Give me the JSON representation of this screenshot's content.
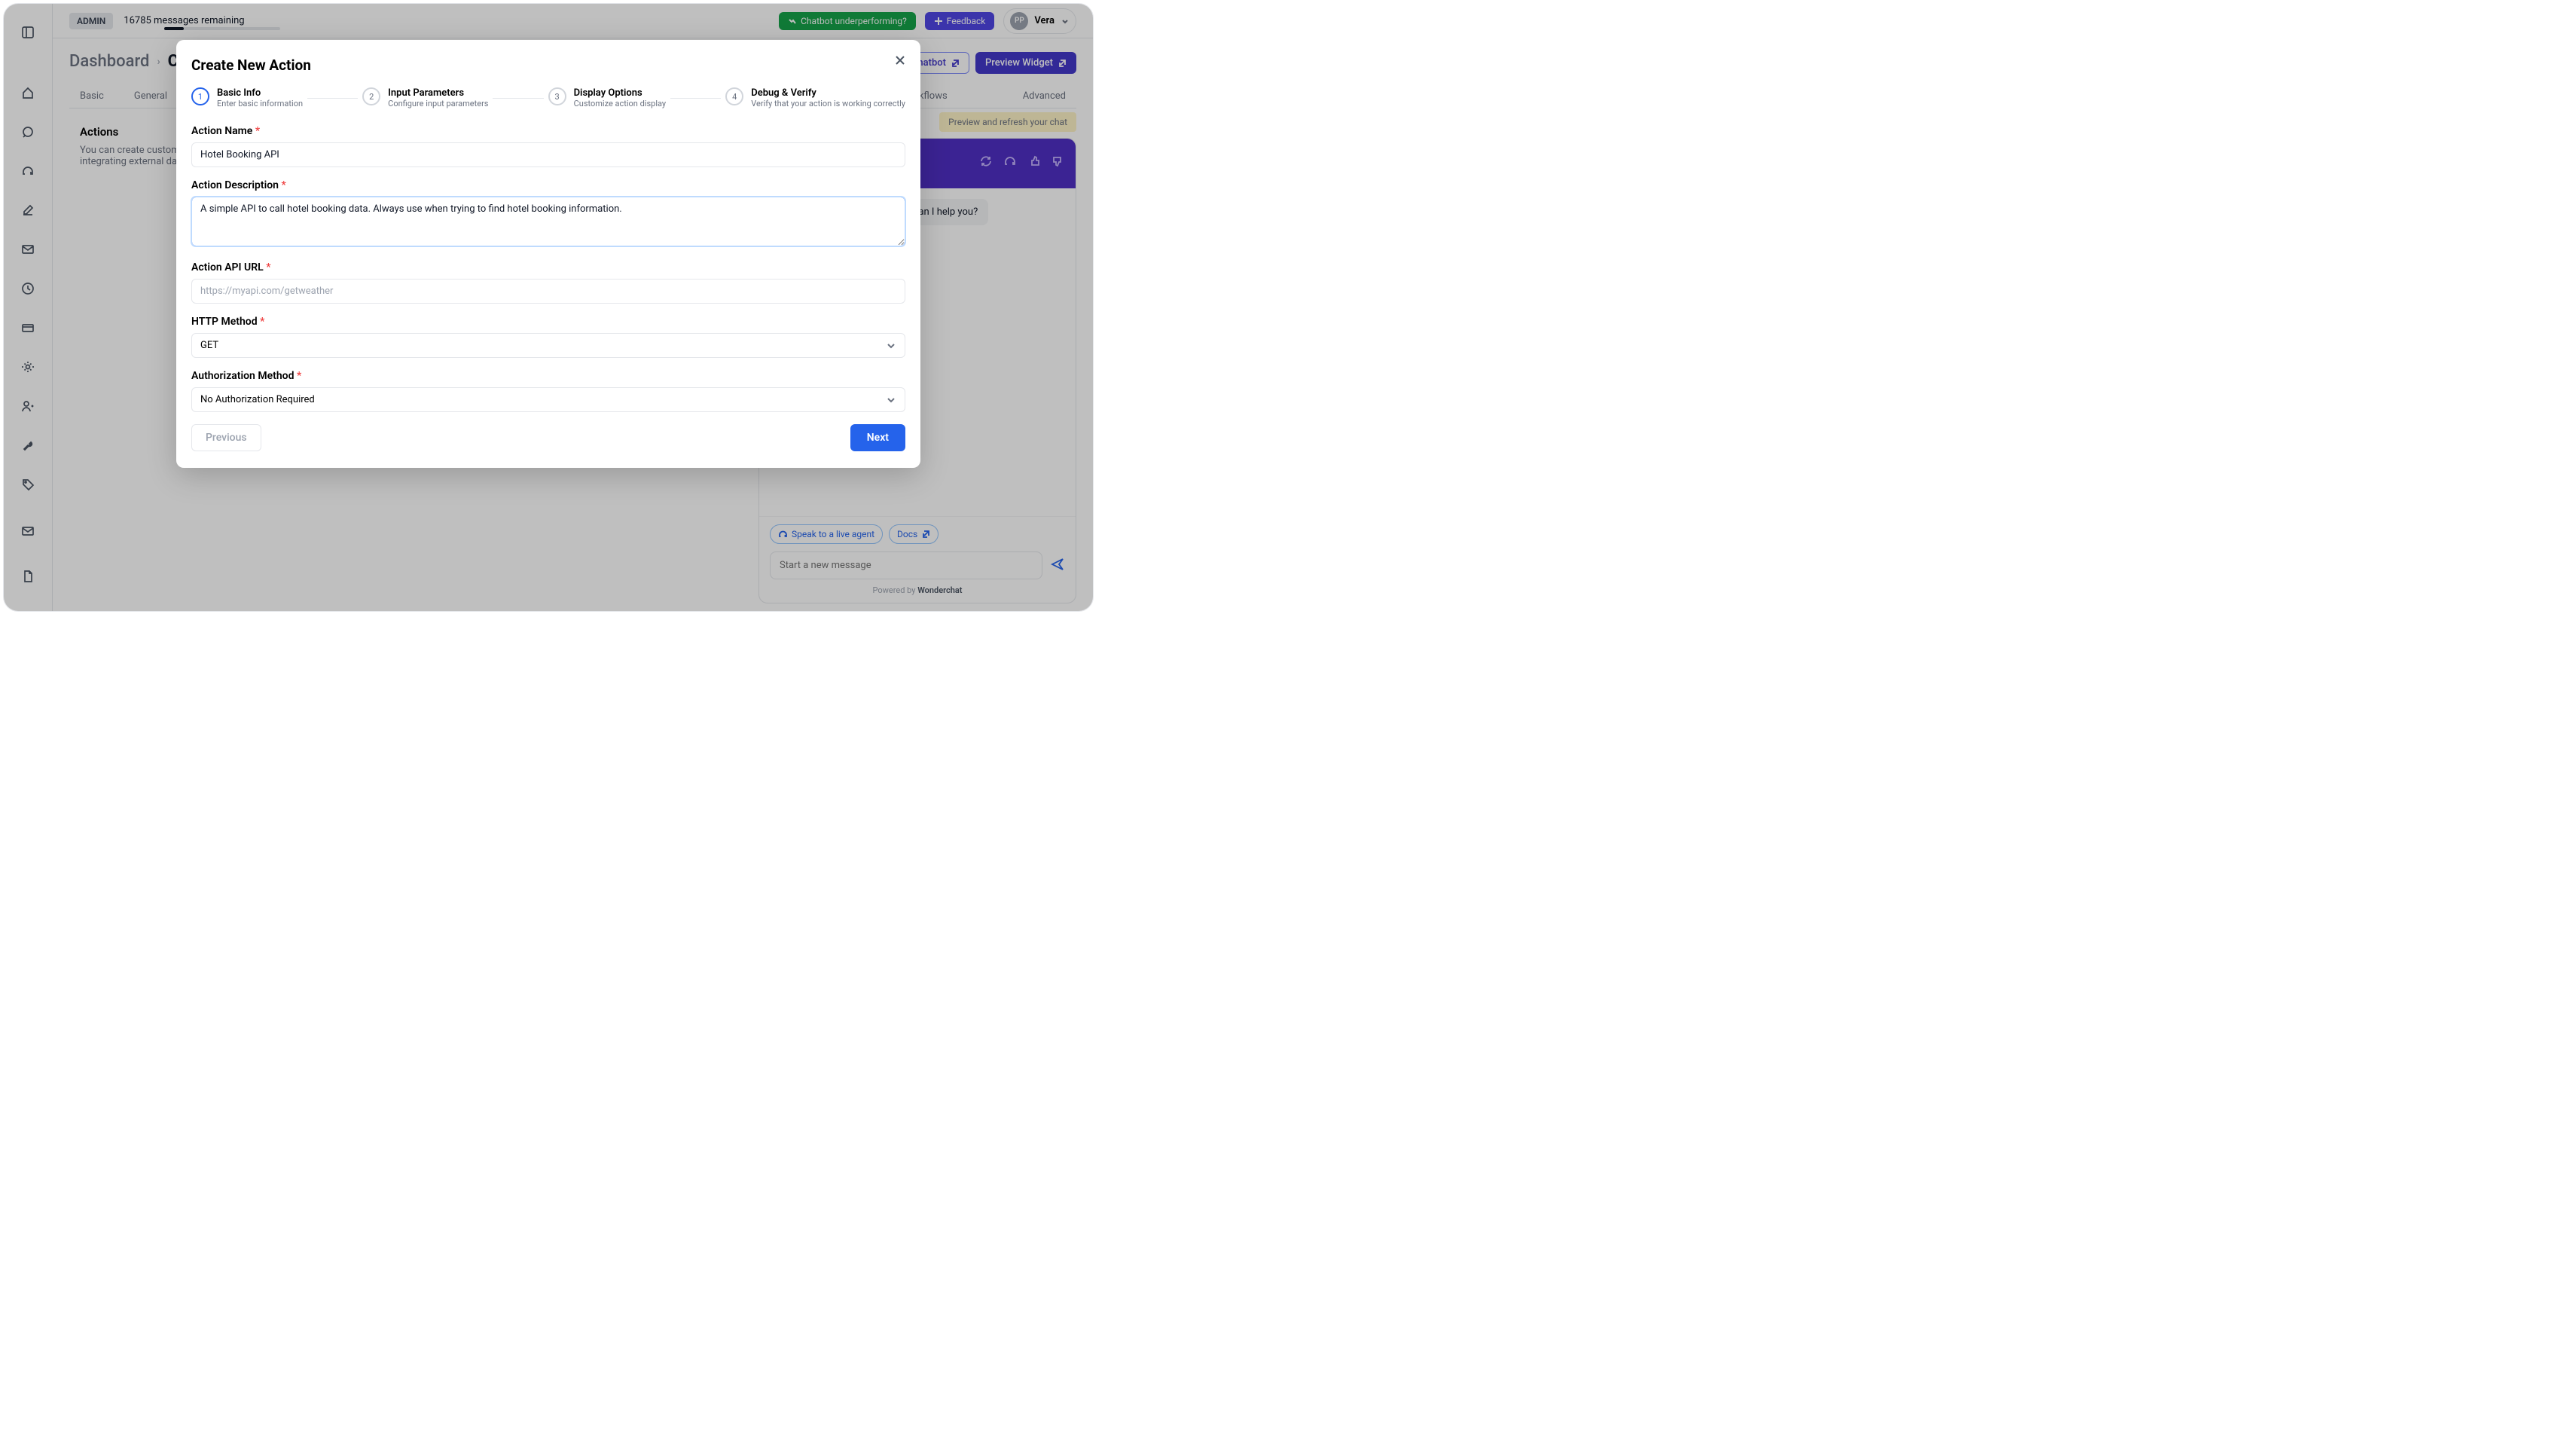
{
  "topbar": {
    "admin_badge": "ADMIN",
    "messages_remaining": "16785 messages remaining",
    "under_btn": "Chatbot underperforming?",
    "feedback_btn": "Feedback",
    "user": {
      "initials": "PP",
      "name": "Vera"
    }
  },
  "breadcrumb": {
    "root": "Dashboard",
    "current": "Chatbot"
  },
  "page_actions": {
    "test_chatbot": "Test Chatbot",
    "preview_widget": "Preview Widget"
  },
  "tabs": {
    "basic": "Basic",
    "general": "General",
    "workflows": "Workflows",
    "advanced": "Advanced"
  },
  "alert": "Preview and refresh your chat",
  "section": {
    "title": "Actions",
    "desc": "You can create custom actions that your chatbot will call when needed. This is particularly useful for integrating external data sources."
  },
  "chat": {
    "greeting": "Hi, I am your AI assistant, how can I help you?",
    "live_agent": "Speak to a live agent",
    "docs": "Docs",
    "placeholder": "Start a new message",
    "powered_prefix": "Powered by ",
    "powered_brand": "Wonderchat"
  },
  "modal": {
    "title": "Create New Action",
    "steps": [
      {
        "num": "1",
        "title": "Basic Info",
        "sub": "Enter basic information"
      },
      {
        "num": "2",
        "title": "Input Parameters",
        "sub": "Configure input parameters"
      },
      {
        "num": "3",
        "title": "Display Options",
        "sub": "Customize action display"
      },
      {
        "num": "4",
        "title": "Debug & Verify",
        "sub": "Verify that your action is working correctly"
      }
    ],
    "fields": {
      "name_label": "Action Name",
      "name_value": "Hotel Booking API",
      "desc_label": "Action Description",
      "desc_value": "A simple API to call hotel booking data. Always use when trying to find hotel booking information.",
      "url_label": "Action API URL",
      "url_placeholder": "https://myapi.com/getweather",
      "method_label": "HTTP Method",
      "method_value": "GET",
      "auth_label": "Authorization Method",
      "auth_value": "No Authorization Required"
    },
    "prev": "Previous",
    "next": "Next"
  }
}
